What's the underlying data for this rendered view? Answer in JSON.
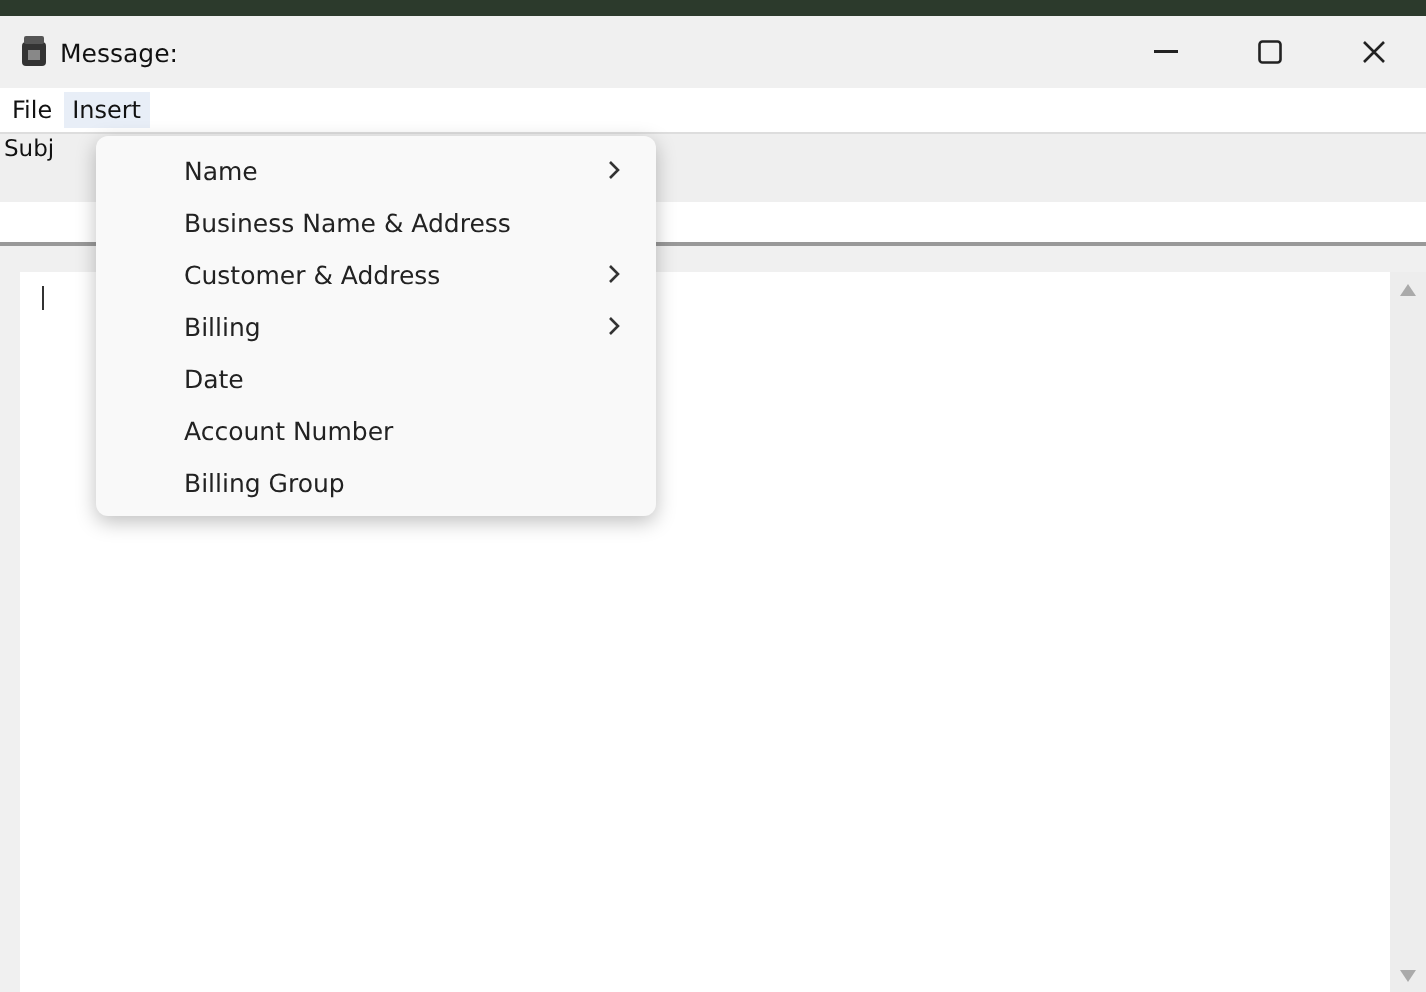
{
  "window": {
    "title": "Message:"
  },
  "menu_bar": [
    {
      "label": "File",
      "selected": false
    },
    {
      "label": "Insert",
      "selected": true
    }
  ],
  "subject": {
    "label": "Subj"
  },
  "insert_menu": [
    {
      "label": "Name",
      "submenu": true
    },
    {
      "label": "Business Name & Address",
      "submenu": false
    },
    {
      "label": "Customer & Address",
      "submenu": true
    },
    {
      "label": "Billing",
      "submenu": true
    },
    {
      "label": "Date",
      "submenu": false
    },
    {
      "label": "Account Number",
      "submenu": false
    },
    {
      "label": "Billing Group",
      "submenu": false
    }
  ]
}
